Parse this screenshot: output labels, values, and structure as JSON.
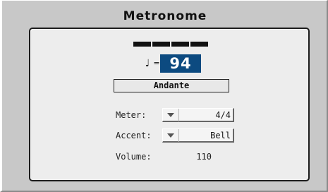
{
  "window": {
    "title": "Metronome"
  },
  "metronome": {
    "beat_count": 4,
    "note_symbol": "♩",
    "equals": "=",
    "tempo": "94",
    "tempo_name": "Andante",
    "meter": {
      "label": "Meter:",
      "value": "4/4"
    },
    "accent": {
      "label": "Accent:",
      "value": "Bell"
    },
    "volume": {
      "label": "Volume:",
      "value": "110"
    }
  },
  "icons": {
    "dropdown": "chevron-down-icon",
    "note": "quarter-note-icon"
  },
  "colors": {
    "tempo_background": "#0c4a80",
    "tempo_text": "#ffffff",
    "window_background": "#c8c8c8",
    "panel_background": "#ededed"
  }
}
